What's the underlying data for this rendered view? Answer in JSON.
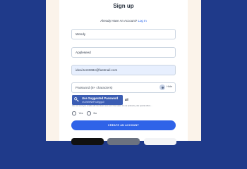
{
  "page": {
    "title": "Sign up",
    "already_text": "Already Have An Account?",
    "login_link": "Log In"
  },
  "form": {
    "first_name_value": "Wendy",
    "last_name_value": "Appleseed",
    "email_value": "ideal.tent3684@fastmail.com",
    "password_placeholder": "Password (8+ characters)",
    "show_label": "Hide",
    "suggest_title": "Use Suggested Password",
    "suggest_value": "xh-bWeNeFnu6yjgu0",
    "suggest_cutoff": "ail",
    "fineprint": "Can we send you emails with the latest news and information on our products, plus special offers…",
    "radio_yes": "Yes",
    "radio_no": "No",
    "create_label": "CREATE AN ACCOUNT"
  },
  "colors": {
    "page_background": "#1f3a8a",
    "primary_button": "#2f63e8",
    "link": "#2563eb",
    "autofill": "#e7effe"
  }
}
